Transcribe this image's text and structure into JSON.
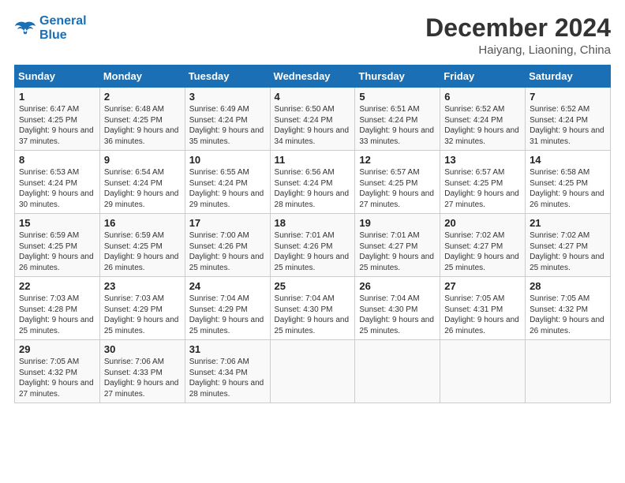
{
  "header": {
    "logo_line1": "General",
    "logo_line2": "Blue",
    "month_title": "December 2024",
    "location": "Haiyang, Liaoning, China"
  },
  "weekdays": [
    "Sunday",
    "Monday",
    "Tuesday",
    "Wednesday",
    "Thursday",
    "Friday",
    "Saturday"
  ],
  "weeks": [
    [
      {
        "day": "1",
        "info": "Sunrise: 6:47 AM\nSunset: 4:25 PM\nDaylight: 9 hours and 37 minutes."
      },
      {
        "day": "2",
        "info": "Sunrise: 6:48 AM\nSunset: 4:25 PM\nDaylight: 9 hours and 36 minutes."
      },
      {
        "day": "3",
        "info": "Sunrise: 6:49 AM\nSunset: 4:24 PM\nDaylight: 9 hours and 35 minutes."
      },
      {
        "day": "4",
        "info": "Sunrise: 6:50 AM\nSunset: 4:24 PM\nDaylight: 9 hours and 34 minutes."
      },
      {
        "day": "5",
        "info": "Sunrise: 6:51 AM\nSunset: 4:24 PM\nDaylight: 9 hours and 33 minutes."
      },
      {
        "day": "6",
        "info": "Sunrise: 6:52 AM\nSunset: 4:24 PM\nDaylight: 9 hours and 32 minutes."
      },
      {
        "day": "7",
        "info": "Sunrise: 6:52 AM\nSunset: 4:24 PM\nDaylight: 9 hours and 31 minutes."
      }
    ],
    [
      {
        "day": "8",
        "info": "Sunrise: 6:53 AM\nSunset: 4:24 PM\nDaylight: 9 hours and 30 minutes."
      },
      {
        "day": "9",
        "info": "Sunrise: 6:54 AM\nSunset: 4:24 PM\nDaylight: 9 hours and 29 minutes."
      },
      {
        "day": "10",
        "info": "Sunrise: 6:55 AM\nSunset: 4:24 PM\nDaylight: 9 hours and 29 minutes."
      },
      {
        "day": "11",
        "info": "Sunrise: 6:56 AM\nSunset: 4:24 PM\nDaylight: 9 hours and 28 minutes."
      },
      {
        "day": "12",
        "info": "Sunrise: 6:57 AM\nSunset: 4:25 PM\nDaylight: 9 hours and 27 minutes."
      },
      {
        "day": "13",
        "info": "Sunrise: 6:57 AM\nSunset: 4:25 PM\nDaylight: 9 hours and 27 minutes."
      },
      {
        "day": "14",
        "info": "Sunrise: 6:58 AM\nSunset: 4:25 PM\nDaylight: 9 hours and 26 minutes."
      }
    ],
    [
      {
        "day": "15",
        "info": "Sunrise: 6:59 AM\nSunset: 4:25 PM\nDaylight: 9 hours and 26 minutes."
      },
      {
        "day": "16",
        "info": "Sunrise: 6:59 AM\nSunset: 4:25 PM\nDaylight: 9 hours and 26 minutes."
      },
      {
        "day": "17",
        "info": "Sunrise: 7:00 AM\nSunset: 4:26 PM\nDaylight: 9 hours and 25 minutes."
      },
      {
        "day": "18",
        "info": "Sunrise: 7:01 AM\nSunset: 4:26 PM\nDaylight: 9 hours and 25 minutes."
      },
      {
        "day": "19",
        "info": "Sunrise: 7:01 AM\nSunset: 4:27 PM\nDaylight: 9 hours and 25 minutes."
      },
      {
        "day": "20",
        "info": "Sunrise: 7:02 AM\nSunset: 4:27 PM\nDaylight: 9 hours and 25 minutes."
      },
      {
        "day": "21",
        "info": "Sunrise: 7:02 AM\nSunset: 4:27 PM\nDaylight: 9 hours and 25 minutes."
      }
    ],
    [
      {
        "day": "22",
        "info": "Sunrise: 7:03 AM\nSunset: 4:28 PM\nDaylight: 9 hours and 25 minutes."
      },
      {
        "day": "23",
        "info": "Sunrise: 7:03 AM\nSunset: 4:29 PM\nDaylight: 9 hours and 25 minutes."
      },
      {
        "day": "24",
        "info": "Sunrise: 7:04 AM\nSunset: 4:29 PM\nDaylight: 9 hours and 25 minutes."
      },
      {
        "day": "25",
        "info": "Sunrise: 7:04 AM\nSunset: 4:30 PM\nDaylight: 9 hours and 25 minutes."
      },
      {
        "day": "26",
        "info": "Sunrise: 7:04 AM\nSunset: 4:30 PM\nDaylight: 9 hours and 25 minutes."
      },
      {
        "day": "27",
        "info": "Sunrise: 7:05 AM\nSunset: 4:31 PM\nDaylight: 9 hours and 26 minutes."
      },
      {
        "day": "28",
        "info": "Sunrise: 7:05 AM\nSunset: 4:32 PM\nDaylight: 9 hours and 26 minutes."
      }
    ],
    [
      {
        "day": "29",
        "info": "Sunrise: 7:05 AM\nSunset: 4:32 PM\nDaylight: 9 hours and 27 minutes."
      },
      {
        "day": "30",
        "info": "Sunrise: 7:06 AM\nSunset: 4:33 PM\nDaylight: 9 hours and 27 minutes."
      },
      {
        "day": "31",
        "info": "Sunrise: 7:06 AM\nSunset: 4:34 PM\nDaylight: 9 hours and 28 minutes."
      },
      null,
      null,
      null,
      null
    ]
  ]
}
